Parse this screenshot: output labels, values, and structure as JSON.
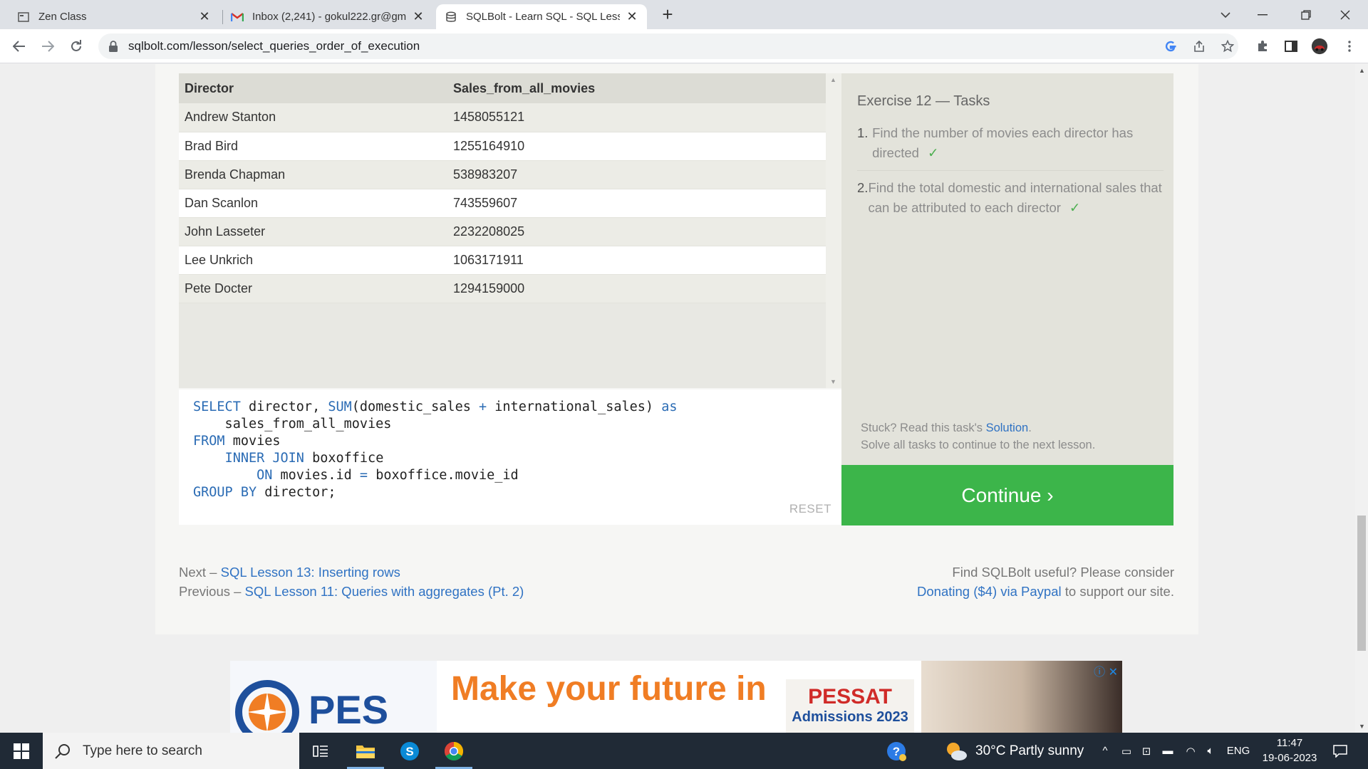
{
  "browser": {
    "tabs": [
      {
        "title": "Zen Class",
        "icon": "zen-class-icon",
        "active": false
      },
      {
        "title": "Inbox (2,241) - gokul222.gr@gm",
        "icon": "gmail-icon",
        "active": false
      },
      {
        "title": "SQLBolt - Learn SQL - SQL Lesso",
        "icon": "database-icon",
        "active": true
      }
    ],
    "url": "sqlbolt.com/lesson/select_queries_order_of_execution"
  },
  "results": {
    "columns": [
      "Director",
      "Sales_from_all_movies"
    ],
    "rows": [
      [
        "Andrew Stanton",
        "1458055121"
      ],
      [
        "Brad Bird",
        "1255164910"
      ],
      [
        "Brenda Chapman",
        "538983207"
      ],
      [
        "Dan Scanlon",
        "743559607"
      ],
      [
        "John Lasseter",
        "2232208025"
      ],
      [
        "Lee Unkrich",
        "1063171911"
      ],
      [
        "Pete Docter",
        "1294159000"
      ]
    ]
  },
  "editor": {
    "lines": [
      [
        {
          "t": "SELECT",
          "k": true
        },
        {
          "t": " director, "
        },
        {
          "t": "SUM",
          "k": true
        },
        {
          "t": "(domestic_sales "
        },
        {
          "t": "+",
          "k": true
        },
        {
          "t": " international_sales) "
        },
        {
          "t": "as",
          "k": true
        }
      ],
      [
        {
          "t": "    sales_from_all_movies"
        }
      ],
      [
        {
          "t": "FROM",
          "k": true
        },
        {
          "t": " movies"
        }
      ],
      [
        {
          "t": "    "
        },
        {
          "t": "INNER JOIN",
          "k": true
        },
        {
          "t": " boxoffice"
        }
      ],
      [
        {
          "t": "        "
        },
        {
          "t": "ON",
          "k": true
        },
        {
          "t": " movies.id "
        },
        {
          "t": "=",
          "k": true
        },
        {
          "t": " boxoffice.movie_id"
        }
      ],
      [
        {
          "t": "GROUP BY",
          "k": true
        },
        {
          "t": " director;"
        }
      ]
    ],
    "reset_label": "RESET"
  },
  "tasks": {
    "heading": "Exercise 12 — Tasks",
    "items": [
      {
        "num": "1.",
        "text": "Find the number of movies each director has directed",
        "check": "✓"
      },
      {
        "num": "2.",
        "text": "Find the total domestic and international sales that can be attributed to each director",
        "check": "✓"
      }
    ],
    "stuck_prefix": "Stuck? Read this task's ",
    "solution_link": "Solution",
    "stuck_suffix": ".",
    "solve_all": "Solve all tasks to continue to the next lesson."
  },
  "continue_label": "Continue ›",
  "footer_nav": {
    "next_prefix": "Next – ",
    "next_link": "SQL Lesson 13: Inserting rows",
    "prev_prefix": "Previous – ",
    "prev_link": "SQL Lesson 11: Queries with aggregates (Pt. 2)",
    "donate_line1": "Find SQLBolt useful? Please consider",
    "donate_link": "Donating ($4) via Paypal",
    "donate_suffix": " to support our site."
  },
  "ad": {
    "logo_text": "PES",
    "headline": "Make your future in",
    "pessat_title": "PESSAT",
    "pessat_sub": "Admissions 2023"
  },
  "taskbar": {
    "search_placeholder": "Type here to search",
    "weather": "30°C  Partly sunny",
    "language": "ENG",
    "time": "11:47",
    "date": "19-06-2023"
  }
}
